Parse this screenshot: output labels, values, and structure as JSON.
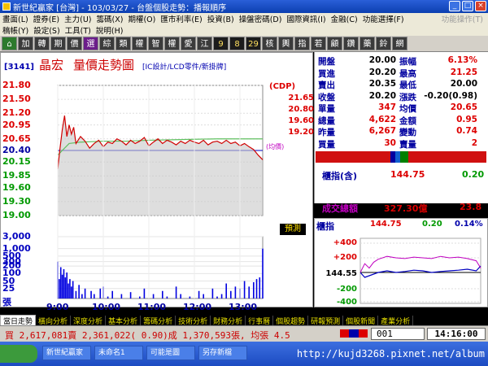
{
  "window": {
    "title": "新世紀贏家 [台灣] - 103/03/27 - 台盤個股走勢：播報順序"
  },
  "menu": {
    "row1": [
      "畫面(L)",
      "證券(E)",
      "主力(U)",
      "籌碼(X)",
      "期權(O)",
      "匯市利率(E)",
      "投資(B)",
      "操盤密碼(D)",
      "國際資訊(I)",
      "金融(C)",
      "功能選擇(F)"
    ],
    "row1_dim": "功能操作(T)",
    "row2": [
      "稿帳(Y)",
      "設定(S)",
      "工具(T)",
      "說明(H)"
    ]
  },
  "toolbar": {
    "buttons": [
      "加",
      "轉",
      "期",
      "價",
      "選",
      "綜",
      "類",
      "權",
      "智",
      "權",
      "愛",
      "江",
      "9",
      "8",
      "29",
      "核",
      "輿",
      "指",
      "若",
      "顧",
      "鑽",
      "藥",
      "鈴",
      "網"
    ]
  },
  "chart": {
    "stock_code": "[3141]",
    "stock_name": "晶宏",
    "chart_kind": "量價走勢圖",
    "industry_tag": "[IC設計/LCD零件/新掛牌]",
    "cdp_label": "(CDP)",
    "cdp_levels": [
      "21.65",
      "20.80",
      "19.60",
      "19.20"
    ],
    "avg_label": "(均價)",
    "predict_label": "預測",
    "volume_unit": "張"
  },
  "chart_data": {
    "type": "line",
    "title": "量價走勢圖",
    "xlabel": "",
    "ylabel": "",
    "x_ticks": [
      "9:00",
      "10:00",
      "11:00",
      "12:00",
      "13:00"
    ],
    "price_ticks": [
      21.8,
      21.5,
      21.2,
      20.95,
      20.65,
      20.4,
      20.15,
      19.85,
      19.6,
      19.3,
      19.0
    ],
    "price_tick_labels": [
      "21.80",
      "21.50",
      "21.20",
      "20.95",
      "20.65",
      "20.40",
      "20.15",
      "19.85",
      "19.60",
      "19.30",
      "19.00"
    ],
    "ylim_price": [
      19.0,
      21.8
    ],
    "reference_price": 20.4,
    "volume_ticks": [
      3000,
      1000,
      500,
      300,
      200,
      100,
      50,
      25
    ],
    "volume_tick_labels": [
      "3,000",
      "1,000",
      "500",
      "300",
      "200",
      "100",
      "50",
      "25"
    ],
    "price_series": {
      "minutes": [
        0,
        3,
        6,
        9,
        12,
        15,
        18,
        21,
        24,
        30,
        36,
        42,
        48,
        54,
        60,
        66,
        72,
        78,
        84,
        90,
        96,
        102,
        108,
        114,
        120,
        126,
        132,
        138,
        144,
        150,
        156,
        162,
        168,
        174,
        180,
        186,
        192,
        198,
        204,
        210,
        216,
        222,
        228,
        234,
        240,
        246,
        252,
        258,
        264,
        270
      ],
      "values": [
        20.0,
        20.45,
        20.85,
        21.15,
        20.7,
        20.95,
        20.75,
        20.9,
        20.55,
        20.7,
        20.6,
        20.45,
        20.55,
        20.62,
        20.48,
        20.58,
        20.55,
        20.65,
        20.6,
        20.52,
        20.62,
        20.55,
        20.6,
        20.68,
        20.5,
        20.58,
        20.65,
        20.55,
        20.62,
        20.58,
        20.52,
        20.6,
        20.55,
        20.62,
        20.58,
        20.55,
        20.62,
        20.52,
        20.58,
        20.6,
        20.55,
        20.62,
        20.55,
        20.58,
        20.5,
        20.55,
        20.48,
        20.42,
        20.3,
        20.2
      ]
    },
    "avg_series": {
      "minutes": [
        0,
        15,
        30,
        60,
        90,
        120,
        150,
        180,
        210,
        240,
        270
      ],
      "values": [
        20.3,
        20.55,
        20.58,
        20.6,
        20.6,
        20.62,
        20.63,
        20.64,
        20.65,
        20.65,
        20.65
      ]
    },
    "volume_series": {
      "minutes": [
        0,
        2,
        4,
        6,
        8,
        10,
        12,
        14,
        16,
        18,
        20,
        24,
        28,
        32,
        36,
        40,
        44,
        48,
        52,
        56,
        60,
        66,
        72,
        78,
        84,
        90,
        96,
        102,
        108,
        114,
        120,
        126,
        132,
        138,
        144,
        150,
        156,
        162,
        168,
        174,
        180,
        186,
        192,
        198,
        204,
        210,
        216,
        222,
        228,
        234,
        240,
        246,
        252,
        258,
        262,
        266,
        270
      ],
      "values": [
        300,
        60,
        180,
        90,
        150,
        70,
        110,
        40,
        60,
        30,
        50,
        20,
        35,
        15,
        25,
        10,
        20,
        15,
        10,
        25,
        30,
        12,
        20,
        8,
        15,
        10,
        18,
        8,
        12,
        25,
        10,
        15,
        8,
        20,
        12,
        10,
        30,
        15,
        8,
        12,
        10,
        20,
        15,
        10,
        25,
        12,
        15,
        40,
        20,
        30,
        25,
        50,
        30,
        45,
        60,
        70,
        1000
      ]
    }
  },
  "quote": {
    "rows": [
      {
        "l1": "開盤",
        "v1": "20.00",
        "l2": "振幅",
        "v2": "6.13%",
        "c2": "red"
      },
      {
        "l1": "買進",
        "v1": "20.20",
        "l2": "最高",
        "v2": "21.25",
        "c2": "red"
      },
      {
        "l1": "賣出",
        "v1": "20.35",
        "l2": "最低",
        "v2": "20.00",
        "c2": "blk"
      },
      {
        "l1": "收盤",
        "v1": "20.20",
        "l2": "漲跌",
        "v2": "-0.20(0.98)",
        "c2": "blk"
      },
      {
        "l1": "單量",
        "v1": "347",
        "l2": "均價",
        "v2": "20.65",
        "c2": "red"
      },
      {
        "l1": "總量",
        "v1": "4,622",
        "l2": "金額",
        "v2": "0.95",
        "c2": "red"
      },
      {
        "l1": "昨量",
        "v1": "6,267",
        "l2": "變動",
        "v2": "0.74",
        "c2": "red"
      },
      {
        "l1": "買量",
        "v1": "30",
        "l2": "賣量",
        "v2": "2",
        "c2": "red"
      }
    ],
    "index_label": "櫃指(含)",
    "index_value": "144.75",
    "index_change": "0.20",
    "turnover_label": "成交總額",
    "turnover_value": "327.30億",
    "turnover_change": "23.8"
  },
  "index_chart": {
    "title": "櫃指",
    "value": "144.75",
    "change": "0.20",
    "pct": "0.14%",
    "ticks": [
      "+400",
      "+200",
      "144.55",
      "-200",
      "-400"
    ]
  },
  "index_chart_data": {
    "type": "line",
    "minutes": [
      0,
      10,
      20,
      30,
      40,
      60,
      80,
      100,
      120,
      140,
      160,
      180,
      200,
      220,
      240,
      260,
      270
    ],
    "index_series": [
      144.55,
      144.4,
      144.45,
      144.5,
      144.55,
      144.6,
      144.55,
      144.58,
      144.62,
      144.6,
      144.55,
      144.58,
      144.6,
      144.62,
      144.65,
      144.6,
      144.75
    ],
    "strength_series": [
      0,
      60,
      30,
      70,
      90,
      110,
      100,
      95,
      105,
      100,
      95,
      110,
      100,
      105,
      95,
      80,
      30
    ]
  },
  "tabs": [
    "當日走勢",
    "橫向分析",
    "深度分析",
    "基本分析",
    "籌碼分析",
    "技術分析",
    "財務分析",
    "行事曆",
    "個股趨勢",
    "研報預測",
    "個股新聞",
    "產業分析"
  ],
  "status": {
    "summary": "買 2,617,081賣 2,361,022( 0.90)成 1,370,593張, 均張 4.5",
    "code": "001",
    "clock": "14:16:00"
  },
  "taskbar": {
    "buttons": [
      "新世紀贏家",
      "未命名1",
      "可能是圖",
      "另存新檔"
    ],
    "url": "http://kujd3268.pixnet.net/album"
  },
  "colors": {
    "price_line": "#d00000",
    "avg_line": "#60c060",
    "reference_line": "#0000c0",
    "volume_bar": "#0000e0",
    "accent_text": "#0000a0"
  }
}
